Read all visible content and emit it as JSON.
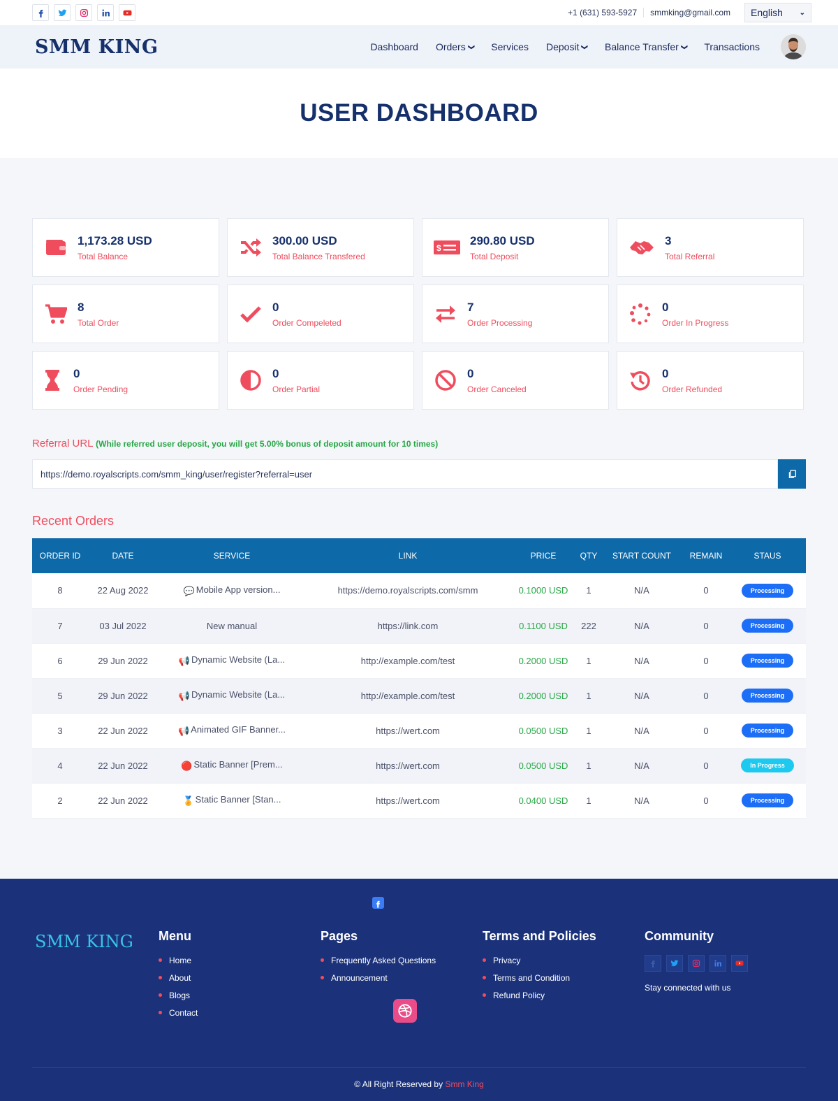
{
  "topbar": {
    "socials": [
      "facebook-icon",
      "twitter-icon",
      "instagram-icon",
      "linkedin-icon",
      "youtube-icon"
    ],
    "phone": "+1 (631) 593-5927",
    "email": "smmking@gmail.com",
    "language": "English"
  },
  "nav": {
    "brand": "SMM KING",
    "items": {
      "dashboard": "Dashboard",
      "orders": "Orders",
      "services": "Services",
      "deposit": "Deposit",
      "balance_transfer": "Balance Transfer",
      "transactions": "Transactions"
    }
  },
  "hero": {
    "title": "USER DASHBOARD"
  },
  "colors": {
    "accent": "#ef4d5e",
    "navy": "#15306b",
    "blue": "#0e69a8",
    "footer": "#1b327b",
    "green": "#27a745"
  },
  "stats": [
    {
      "value": "1,173.28 USD",
      "label": "Total Balance",
      "icon": "wallet-icon"
    },
    {
      "value": "300.00 USD",
      "label": "Total Balance Transfered",
      "icon": "shuffle-icon"
    },
    {
      "value": "290.80 USD",
      "label": "Total Deposit",
      "icon": "money-bill-icon"
    },
    {
      "value": "3",
      "label": "Total Referral",
      "icon": "handshake-icon"
    },
    {
      "value": "8",
      "label": "Total Order",
      "icon": "cart-icon"
    },
    {
      "value": "0",
      "label": "Order Compeleted",
      "icon": "check-icon"
    },
    {
      "value": "7",
      "label": "Order Processing",
      "icon": "exchange-icon"
    },
    {
      "value": "0",
      "label": "Order In Progress",
      "icon": "spinner-icon"
    },
    {
      "value": "0",
      "label": "Order Pending",
      "icon": "hourglass-icon"
    },
    {
      "value": "0",
      "label": "Order Partial",
      "icon": "half-circle-icon"
    },
    {
      "value": "0",
      "label": "Order Canceled",
      "icon": "ban-icon"
    },
    {
      "value": "0",
      "label": "Order Refunded",
      "icon": "history-icon"
    }
  ],
  "referral": {
    "title": "Referral URL",
    "note": "(While referred user deposit, you will get 5.00% bonus of deposit amount for 10 times)",
    "url": "https://demo.royalscripts.com/smm_king/user/register?referral=user"
  },
  "recent_orders": {
    "title": "Recent Orders",
    "headers": [
      "ORDER ID",
      "DATE",
      "SERVICE",
      "LINK",
      "PRICE",
      "QTY",
      "START COUNT",
      "REMAIN",
      "STAUS"
    ],
    "rows": [
      {
        "id": "8",
        "date": "22 Aug 2022",
        "service_icon": "💬",
        "service": "Mobile App version...",
        "link": "https://demo.royalscripts.com/smm",
        "price": "0.1000 USD",
        "qty": "1",
        "start": "N/A",
        "remain": "0",
        "status": "Processing"
      },
      {
        "id": "7",
        "date": "03 Jul 2022",
        "service_icon": "",
        "service": "New manual",
        "link": "https://link.com",
        "price": "0.1100 USD",
        "qty": "222",
        "start": "N/A",
        "remain": "0",
        "status": "Processing"
      },
      {
        "id": "6",
        "date": "29 Jun 2022",
        "service_icon": "📢",
        "service": "Dynamic Website (La...",
        "link": "http://example.com/test",
        "price": "0.2000 USD",
        "qty": "1",
        "start": "N/A",
        "remain": "0",
        "status": "Processing"
      },
      {
        "id": "5",
        "date": "29 Jun 2022",
        "service_icon": "📢",
        "service": "Dynamic Website (La...",
        "link": "http://example.com/test",
        "price": "0.2000 USD",
        "qty": "1",
        "start": "N/A",
        "remain": "0",
        "status": "Processing"
      },
      {
        "id": "3",
        "date": "22 Jun 2022",
        "service_icon": "📢",
        "service": "Animated GIF Banner...",
        "link": "https://wert.com",
        "price": "0.0500 USD",
        "qty": "1",
        "start": "N/A",
        "remain": "0",
        "status": "Processing"
      },
      {
        "id": "4",
        "date": "22 Jun 2022",
        "service_icon": "🔴",
        "service": "Static Banner [Prem...",
        "link": "https://wert.com",
        "price": "0.0500 USD",
        "qty": "1",
        "start": "N/A",
        "remain": "0",
        "status": "In Progress"
      },
      {
        "id": "2",
        "date": "22 Jun 2022",
        "service_icon": "🏅",
        "service": "Static Banner [Stan...",
        "link": "https://wert.com",
        "price": "0.0400 USD",
        "qty": "1",
        "start": "N/A",
        "remain": "0",
        "status": "Processing"
      }
    ]
  },
  "footer": {
    "brand": "SMM KING",
    "menu": {
      "title": "Menu",
      "items": [
        "Home",
        "About",
        "Blogs",
        "Contact"
      ]
    },
    "pages": {
      "title": "Pages",
      "items": [
        "Frequently Asked Questions",
        "Announcement"
      ]
    },
    "terms": {
      "title": "Terms and Policies",
      "items": [
        "Privacy",
        "Terms and Condition",
        "Refund Policy"
      ]
    },
    "community": {
      "title": "Community",
      "tagline": "Stay connected with us"
    },
    "copyright": "© All Right Reserved by",
    "copyright_brand": "Smm King"
  }
}
